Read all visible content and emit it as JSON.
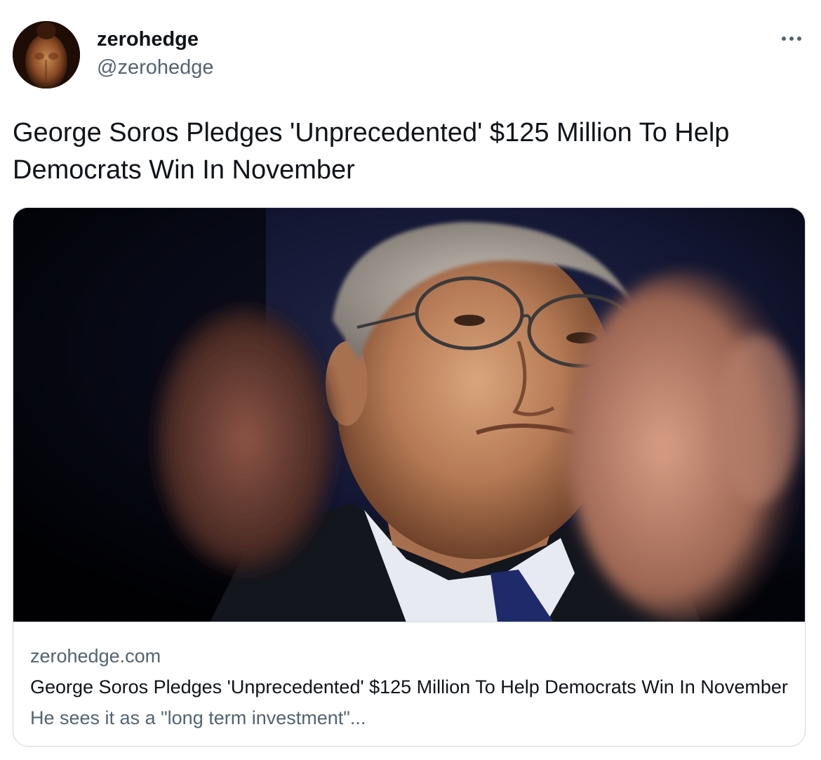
{
  "author": {
    "display_name": "zerohedge",
    "handle": "@zerohedge",
    "avatar_icon": "profile-avatar"
  },
  "menu": {
    "icon": "more-dots-icon"
  },
  "tweet": {
    "text": "George Soros Pledges 'Unprecedented' $125 Million To Help Democrats Win In November"
  },
  "card": {
    "domain": "zerohedge.com",
    "title": "George Soros Pledges 'Unprecedented' $125 Million To Help Democrats Win In November",
    "description": "He sees it as a \"long term investment\"..."
  },
  "colors": {
    "text_primary": "#0f1419",
    "text_secondary": "#536471",
    "border": "#cfd9de"
  }
}
